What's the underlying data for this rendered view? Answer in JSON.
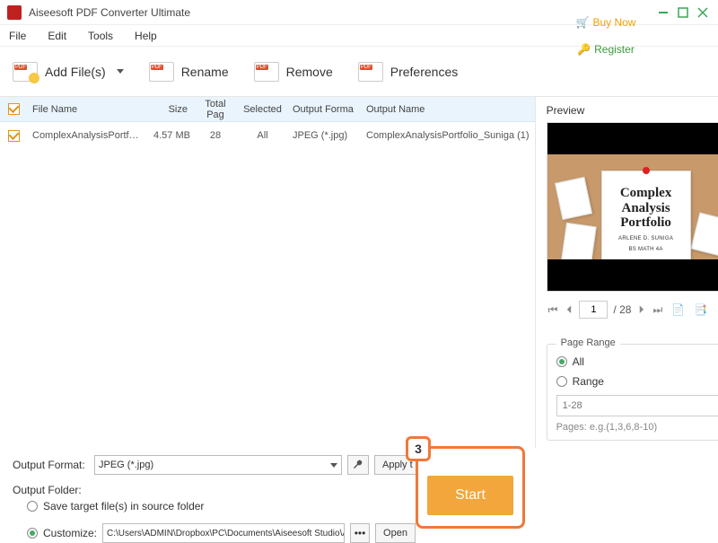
{
  "titlebar": {
    "title": "Aiseesoft PDF Converter Ultimate"
  },
  "menubar": {
    "items": [
      "File",
      "Edit",
      "Tools",
      "Help"
    ],
    "buy": "Buy Now",
    "register": "Register"
  },
  "toolbar": {
    "addfiles": "Add File(s)",
    "rename": "Rename",
    "remove": "Remove",
    "preferences": "Preferences"
  },
  "table": {
    "headers": {
      "filename": "File Name",
      "size": "Size",
      "totalpages": "Total Pag",
      "selected": "Selected",
      "outputformat": "Output Forma",
      "outputname": "Output Name"
    },
    "rows": [
      {
        "filename": "ComplexAnalysisPortfolio_S...",
        "size": "4.57 MB",
        "pages": "28",
        "selected": "All",
        "format": "JPEG (*.jpg)",
        "outname": "ComplexAnalysisPortfolio_Suniga (1)"
      }
    ]
  },
  "preview": {
    "label": "Preview",
    "doc_title": "Complex Analysis Portfolio",
    "doc_author": "ARLENE D. SUNIGA",
    "doc_sub": "BS MATH 4A",
    "page_current": "1",
    "page_total": "/ 28"
  },
  "pagerange": {
    "legend": "Page Range",
    "all": "All",
    "range": "Range",
    "placeholder": "1-28",
    "hint": "Pages: e.g.(1,3,6,8-10)"
  },
  "bottom": {
    "outputformat_lbl": "Output Format:",
    "outputformat_val": "JPEG (*.jpg)",
    "apply": "Apply t",
    "outputfolder_lbl": "Output Folder:",
    "save_source": "Save target file(s) in source folder",
    "customize": "Customize:",
    "path": "C:\\Users\\ADMIN\\Dropbox\\PC\\Documents\\Aiseesoft Studio\\Aiseesoft P",
    "open": "Open",
    "start": "Start",
    "badge": "3"
  }
}
